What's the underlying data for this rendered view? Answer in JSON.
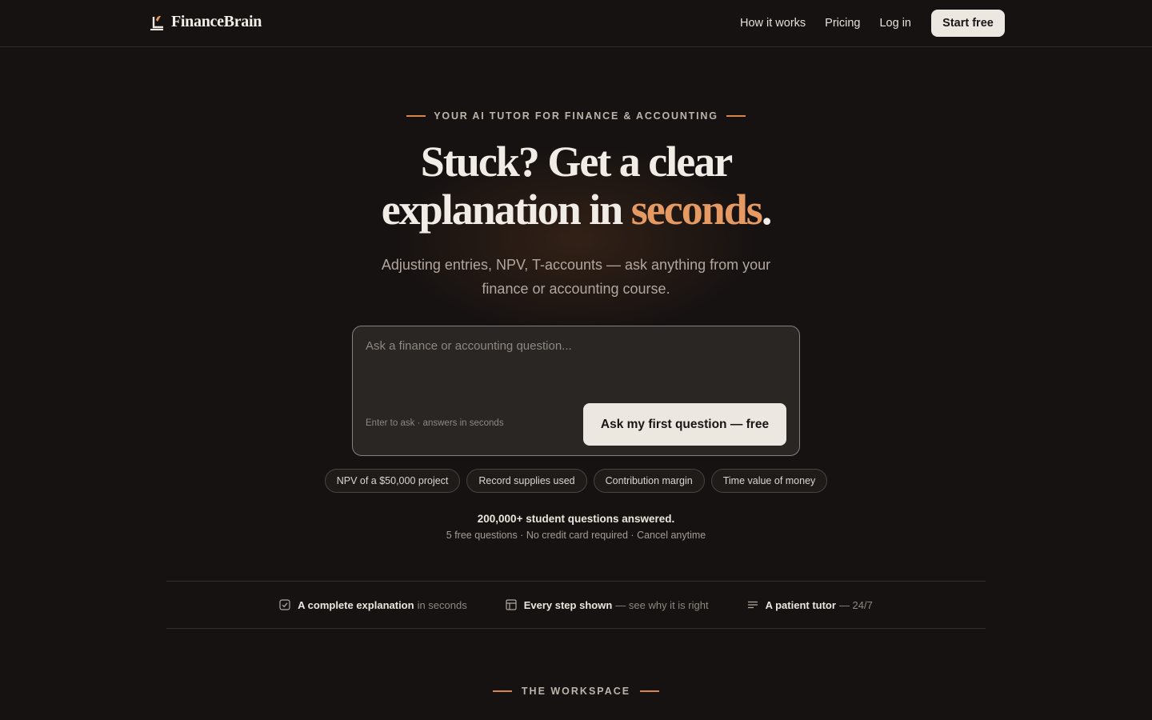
{
  "brand": {
    "name": "FinanceBrain",
    "icon": "brand-mark-icon",
    "accent": "#e59a63"
  },
  "nav": {
    "links": [
      "How it works",
      "Pricing",
      "Log in"
    ],
    "cta": "Start free"
  },
  "hero": {
    "eyebrow": "YOUR AI TUTOR FOR FINANCE & ACCOUNTING",
    "headline_line1": "Stuck? Get a clear",
    "headline_line2_pre": "explanation in ",
    "headline_accent": "seconds",
    "headline_end": ".",
    "subhead": "Adjusting entries, NPV, T-accounts — ask anything from your finance or accounting course."
  },
  "ask": {
    "placeholder": "Ask a finance or accounting question...",
    "hint": "Enter to ask · answers in seconds",
    "button": "Ask my first question — free"
  },
  "chips": [
    "NPV of a $50,000 project",
    "Record supplies used",
    "Contribution margin",
    "Time value of money"
  ],
  "stats": {
    "main": "200,000+ student questions answered.",
    "sub": "5 free questions · No credit card required · Cancel anytime"
  },
  "features": [
    {
      "icon": "check-square-icon",
      "title": "A complete explanation",
      "rest": "in seconds"
    },
    {
      "icon": "steps-icon",
      "title": "Every step shown",
      "rest": "— see why it is right"
    },
    {
      "icon": "lines-icon",
      "title": "A patient tutor",
      "rest": "— 24/7"
    }
  ],
  "workspace": {
    "eyebrow": "THE WORKSPACE"
  }
}
